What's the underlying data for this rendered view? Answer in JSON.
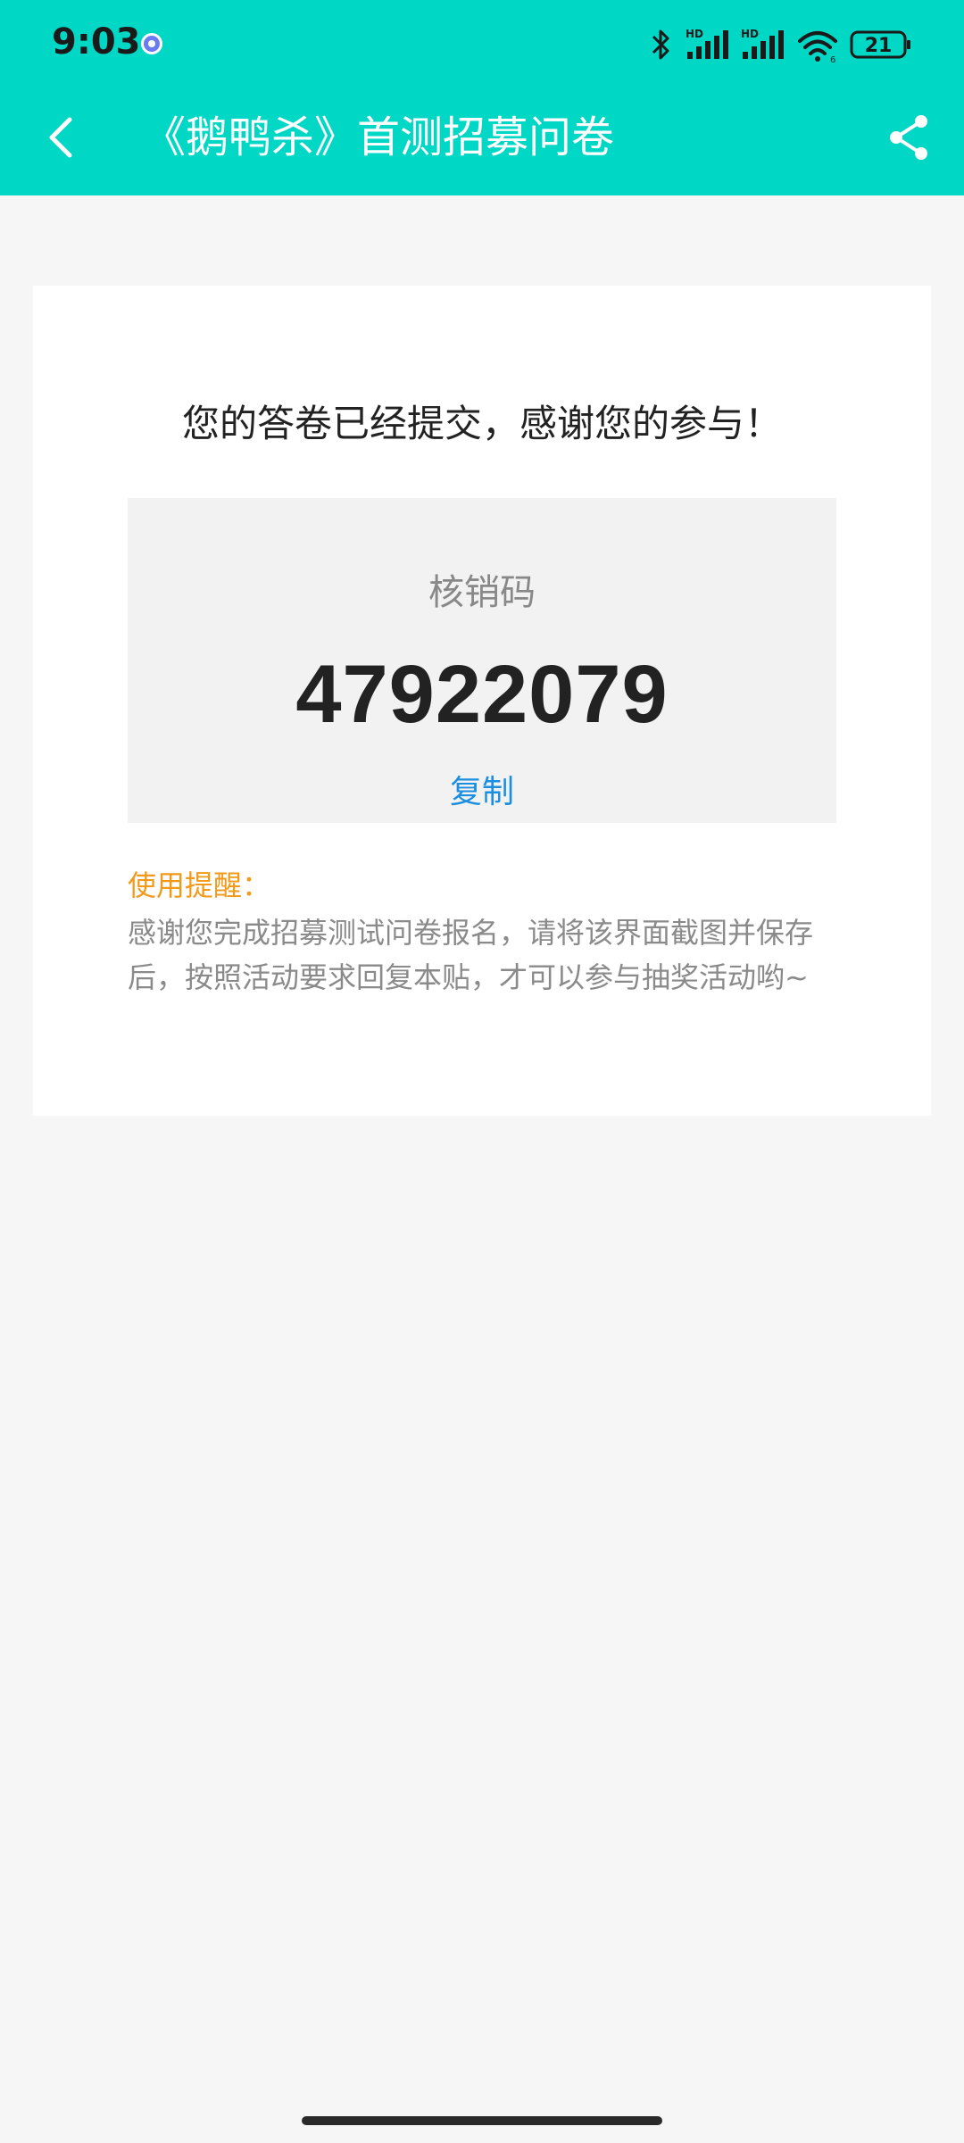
{
  "status_bar": {
    "time": "9:03",
    "battery_level": "21",
    "icons": [
      "bluetooth-icon",
      "hd-signal-icon",
      "hd-signal-icon",
      "wifi-icon",
      "battery-icon"
    ]
  },
  "header": {
    "title": "《鹅鸭杀》首测招募问卷",
    "back_icon": "chevron-left-icon",
    "share_icon": "share-icon",
    "color": "#00d7c4"
  },
  "result": {
    "message": "您的答卷已经提交，感谢您的参与！",
    "code_label": "核销码",
    "code_value": "47922079",
    "copy_label": "复制"
  },
  "reminder": {
    "title": "使用提醒：",
    "body": "感谢您完成招募测试问卷报名，请将该界面截图并保存后，按照活动要求回复本贴，才可以参与抽奖活动哟~"
  }
}
